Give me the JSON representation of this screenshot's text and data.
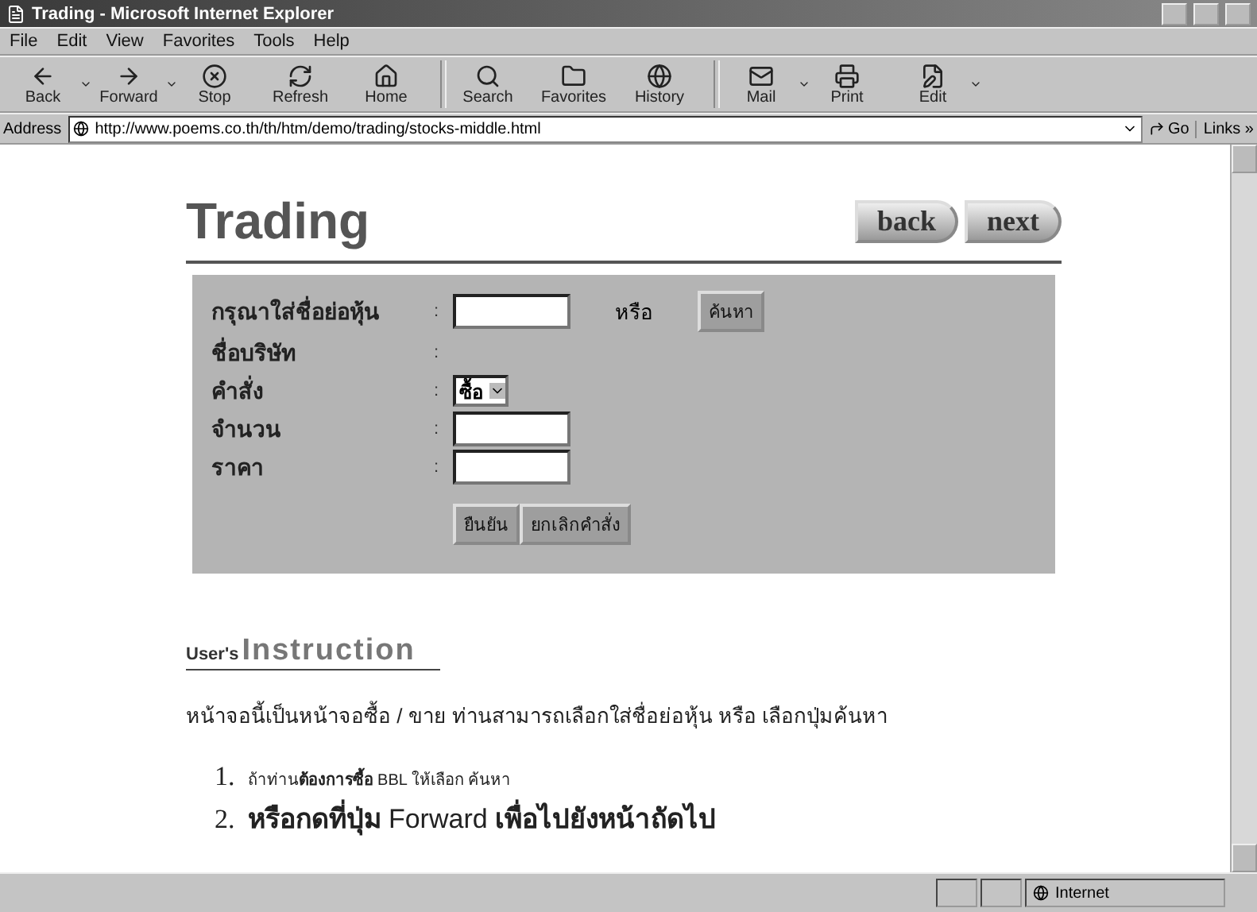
{
  "window": {
    "title": "Trading - Microsoft Internet Explorer"
  },
  "menu": [
    "File",
    "Edit",
    "View",
    "Favorites",
    "Tools",
    "Help"
  ],
  "toolbar": [
    {
      "kind": "back",
      "label": "Back",
      "has_menu": true
    },
    {
      "kind": "forward",
      "label": "Forward",
      "has_menu": true
    },
    {
      "kind": "stop",
      "label": "Stop",
      "has_menu": false
    },
    {
      "kind": "refresh",
      "label": "Refresh",
      "has_menu": false
    },
    {
      "kind": "home",
      "label": "Home",
      "has_menu": false
    },
    {
      "kind": "search",
      "label": "Search",
      "has_menu": false
    },
    {
      "kind": "favorites",
      "label": "Favorites",
      "has_menu": false
    },
    {
      "kind": "history",
      "label": "History",
      "has_menu": false
    },
    {
      "kind": "mail",
      "label": "Mail",
      "has_menu": true
    },
    {
      "kind": "print",
      "label": "Print",
      "has_menu": false
    },
    {
      "kind": "edit",
      "label": "Edit",
      "has_menu": true
    }
  ],
  "address": {
    "label": "Address",
    "url": "http://www.poems.co.th/th/htm/demo/trading/stocks-middle.html",
    "go": "Go",
    "links": "Links »"
  },
  "page": {
    "title": "Trading",
    "nav": [
      "back",
      "next"
    ],
    "form": {
      "rows": [
        {
          "kind": "input",
          "label": "กรุณาใส่ชื่อย่อหุ้น",
          "colon": ":",
          "or": "หรือ",
          "button": "ค้นหา"
        },
        {
          "kind": "text",
          "label": "ชื่อบริษัท",
          "colon": ":"
        },
        {
          "kind": "select",
          "label": "คำสั่ง",
          "colon": ":",
          "value": "ซื้อ"
        },
        {
          "kind": "input",
          "label": "จำนวน",
          "colon": ":"
        },
        {
          "kind": "input",
          "label": "ราคา",
          "colon": ":"
        }
      ],
      "buttons": [
        "ยืนยัน",
        "ยกเลิกคำสั่ง"
      ]
    },
    "instruction": {
      "lead": "User's",
      "title": "Instruction"
    },
    "paragraph": "หน้าจอนี้เป็นหน้าจอซื้อ / ขาย ท่านสามารถเลือกใส่ชื่อย่อหุ้น หรือ เลือกปุ่มค้นหา",
    "steps": [
      {
        "kind": "note",
        "number": "1.",
        "text": "ถ้าท่าน**ต้องการซื้อ** BBL ให้เลือก ค้นหา"
      },
      {
        "kind": "step",
        "number": "2.",
        "text": "**หรือกดที่ปุ่ม** Forward **เพื่อไปยังหน้าถัดไป**"
      }
    ]
  },
  "status_bar": {
    "zone": "Internet"
  }
}
